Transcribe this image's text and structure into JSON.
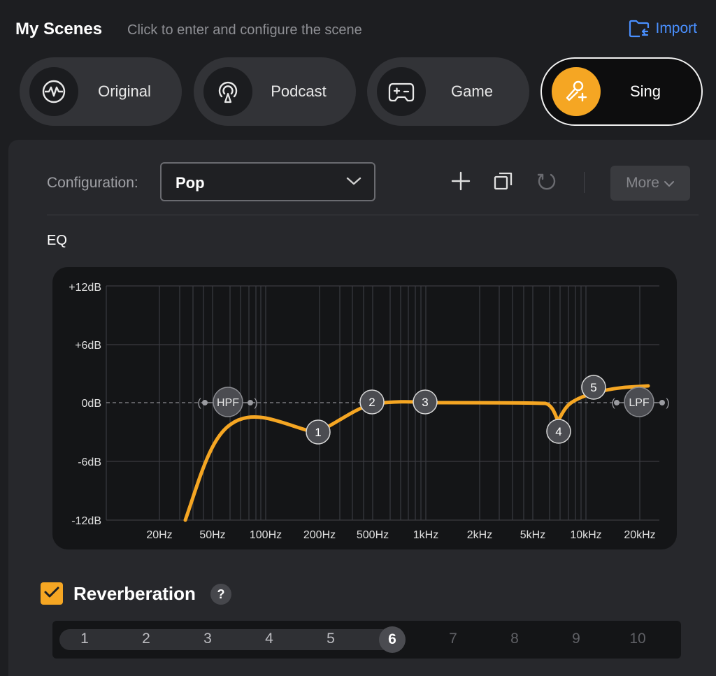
{
  "header": {
    "title": "My Scenes",
    "subtitle": "Click to enter and configure the scene",
    "import_label": "Import",
    "import_icon": "folder-import-icon",
    "accent_color": "#4a90ff"
  },
  "scenes": [
    {
      "label": "Original",
      "icon": "waveform-icon",
      "active": false
    },
    {
      "label": "Podcast",
      "icon": "podcast-icon",
      "active": false
    },
    {
      "label": "Game",
      "icon": "gamepad-icon",
      "active": false
    },
    {
      "label": "Sing",
      "icon": "microphone-sparkle-icon",
      "active": true
    }
  ],
  "configuration": {
    "label": "Configuration:",
    "selected": "Pop",
    "more_label": "More",
    "tools": [
      "add-icon",
      "copy-icon",
      "reset-icon"
    ]
  },
  "eq": {
    "title": "EQ",
    "y_ticks": [
      "+12dB",
      "+6dB",
      "0dB",
      "-6dB",
      "-12dB"
    ],
    "x_ticks": [
      "20Hz",
      "50Hz",
      "100Hz",
      "200Hz",
      "500Hz",
      "1kHz",
      "2kHz",
      "5kHz",
      "10kHz",
      "20kHz"
    ],
    "hpf_label": "HPF",
    "lpf_label": "LPF",
    "bands": [
      "1",
      "2",
      "3",
      "4",
      "5"
    ],
    "curve_color": "#f5a623"
  },
  "reverberation": {
    "title": "Reverberation",
    "help": "?",
    "enabled": true,
    "levels": [
      "1",
      "2",
      "3",
      "4",
      "5",
      "6",
      "7",
      "8",
      "9",
      "10"
    ],
    "selected": 6
  }
}
